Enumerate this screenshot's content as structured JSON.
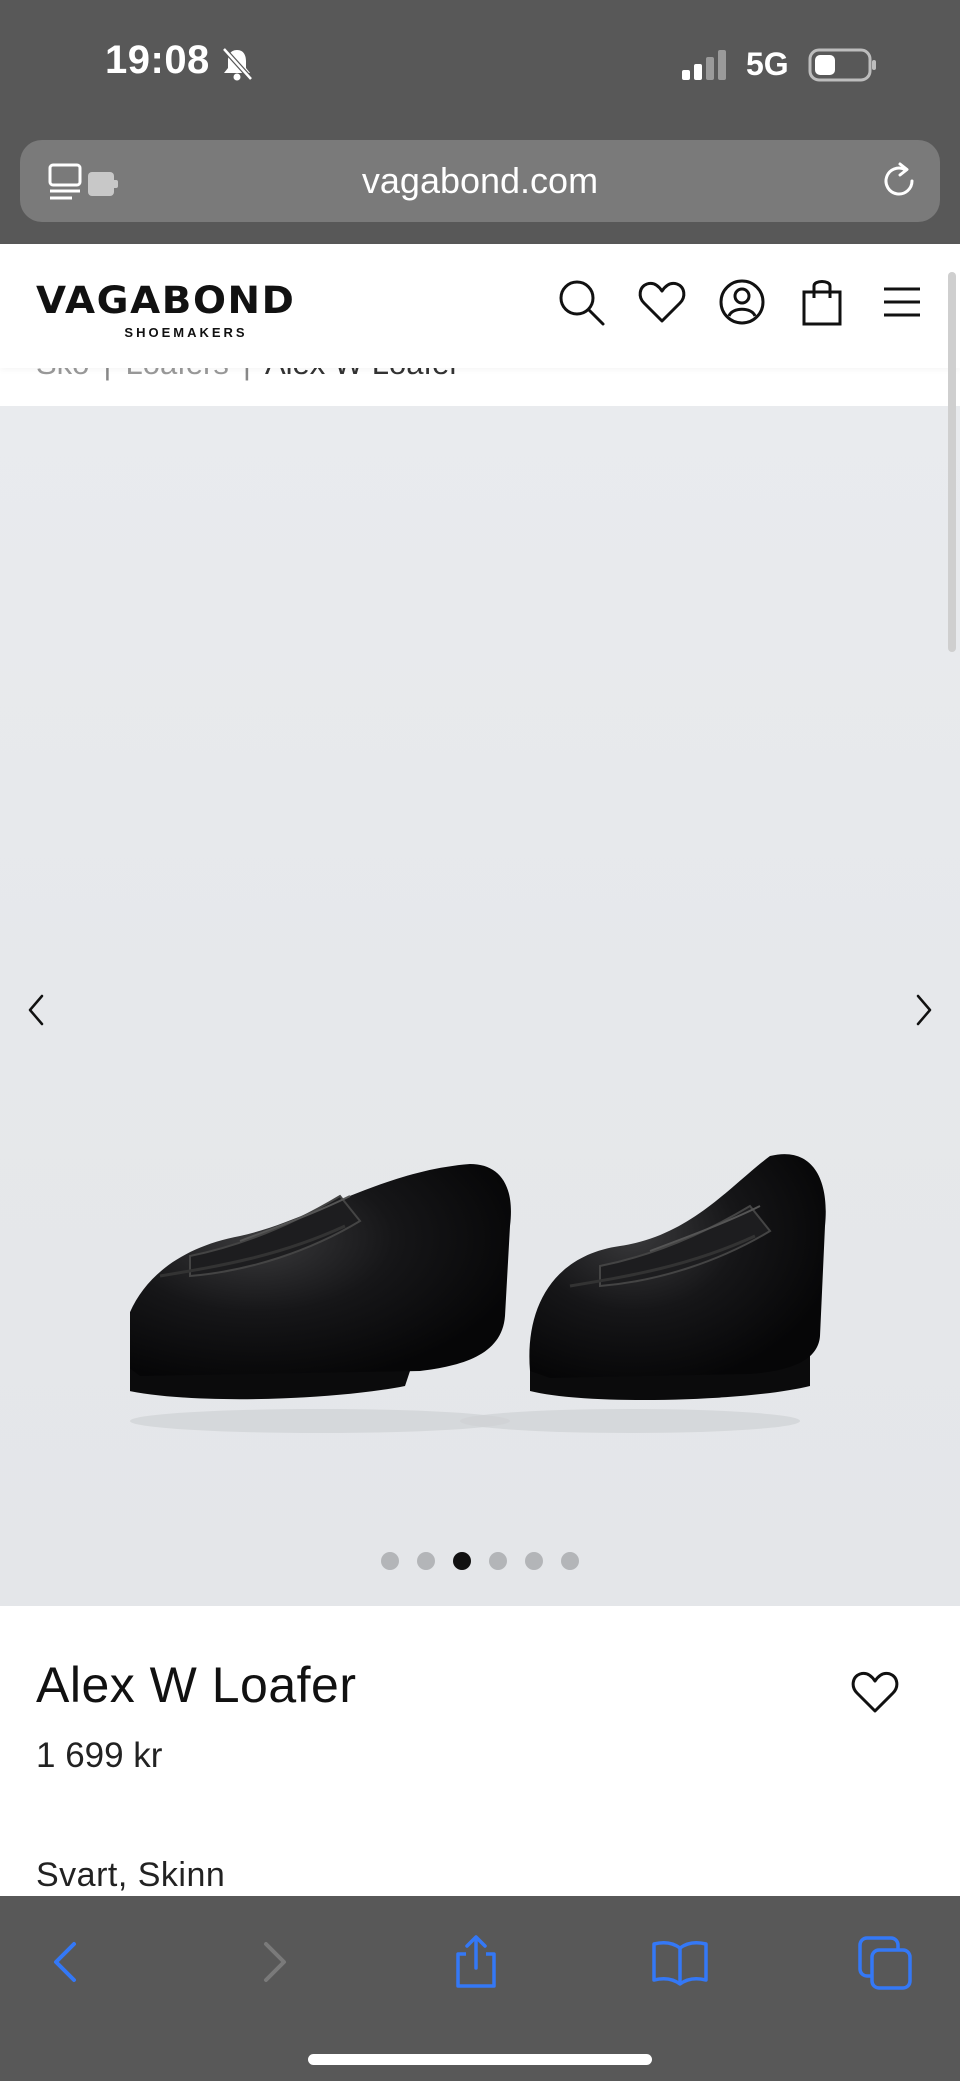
{
  "status_bar": {
    "time": "19:08",
    "network": "5G"
  },
  "browser": {
    "url": "vagabond.com"
  },
  "header": {
    "logo_main": "VAGABOND",
    "logo_sub": "SHOEMAKERS"
  },
  "breadcrumb": {
    "items": [
      "Sko",
      "Loafers",
      "Alex W Loafer"
    ],
    "separator": "|"
  },
  "gallery": {
    "image_count": 6,
    "active_index": 2
  },
  "product": {
    "title": "Alex W Loafer",
    "price": "1 699 kr",
    "color_material": "Svart, Skinn"
  },
  "colors": {
    "browser_chrome": "#585858",
    "toolbar_accent": "#3478f6",
    "gallery_bg": "#e7e9ec",
    "active_dot": "#111111"
  }
}
